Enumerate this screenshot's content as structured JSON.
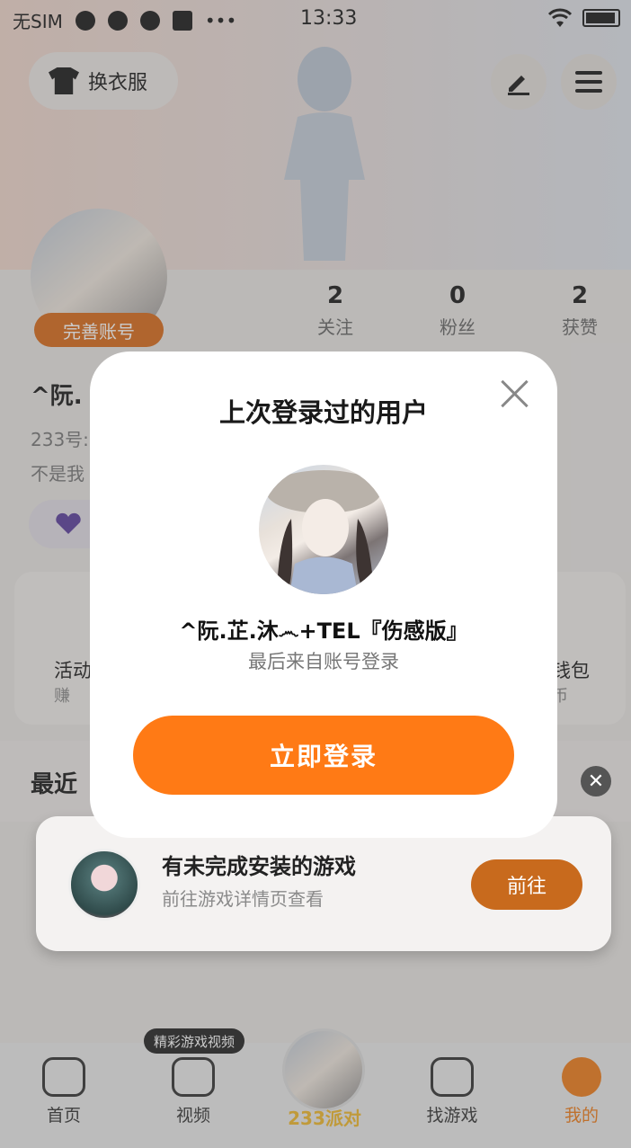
{
  "status_bar": {
    "carrier": "无SIM",
    "time": "13:33",
    "more": "•••"
  },
  "header": {
    "change_outfit_label": "换衣服",
    "icons": [
      "shirt-icon",
      "edit-pen-icon",
      "menu-icon"
    ]
  },
  "profile": {
    "complete_account_label": "完善账号",
    "stats": [
      {
        "value": "2",
        "label": "关注"
      },
      {
        "value": "0",
        "label": "粉丝"
      },
      {
        "value": "2",
        "label": "获赞"
      }
    ],
    "name_partial": "^阮.",
    "id_partial": "233号:",
    "sign_partial": "不是我",
    "recent_partial": "最近"
  },
  "shortcuts": {
    "left_label": "活动",
    "left_sub": "赚",
    "right_label": "钱包",
    "right_sub": "币"
  },
  "notification": {
    "title": "有未完成安装的游戏",
    "subtitle": "前往游戏详情页查看",
    "button_label": "前往"
  },
  "modal": {
    "title": "上次登录过的用户",
    "username": "^阮.芷.沐෴+TEL『伤感版』",
    "source_text": "最后来自账号登录",
    "login_button": "立即登录"
  },
  "tabbar": {
    "tabs": [
      {
        "label": "首页",
        "icon": "gamepad-icon"
      },
      {
        "label": "视频",
        "icon": "play-icon"
      },
      {
        "label": "233派对",
        "icon": "party-avatar-icon"
      },
      {
        "label": "找游戏",
        "icon": "list-icon"
      },
      {
        "label": "我的",
        "icon": "me-face-icon"
      }
    ],
    "video_tooltip": "精彩游戏视频"
  },
  "colors": {
    "accent": "#ff7a15",
    "overlay": "#5a5a5a"
  }
}
